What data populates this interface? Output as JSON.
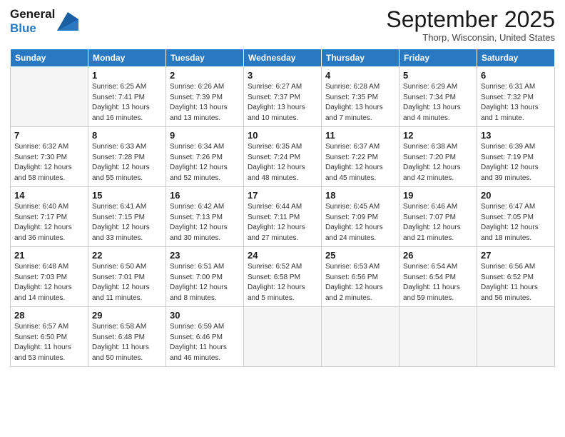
{
  "header": {
    "logo_line1": "General",
    "logo_line2": "Blue",
    "month_title": "September 2025",
    "location": "Thorp, Wisconsin, United States"
  },
  "days_of_week": [
    "Sunday",
    "Monday",
    "Tuesday",
    "Wednesday",
    "Thursday",
    "Friday",
    "Saturday"
  ],
  "weeks": [
    [
      {
        "day": "",
        "info": ""
      },
      {
        "day": "1",
        "info": "Sunrise: 6:25 AM\nSunset: 7:41 PM\nDaylight: 13 hours\nand 16 minutes."
      },
      {
        "day": "2",
        "info": "Sunrise: 6:26 AM\nSunset: 7:39 PM\nDaylight: 13 hours\nand 13 minutes."
      },
      {
        "day": "3",
        "info": "Sunrise: 6:27 AM\nSunset: 7:37 PM\nDaylight: 13 hours\nand 10 minutes."
      },
      {
        "day": "4",
        "info": "Sunrise: 6:28 AM\nSunset: 7:35 PM\nDaylight: 13 hours\nand 7 minutes."
      },
      {
        "day": "5",
        "info": "Sunrise: 6:29 AM\nSunset: 7:34 PM\nDaylight: 13 hours\nand 4 minutes."
      },
      {
        "day": "6",
        "info": "Sunrise: 6:31 AM\nSunset: 7:32 PM\nDaylight: 13 hours\nand 1 minute."
      }
    ],
    [
      {
        "day": "7",
        "info": "Sunrise: 6:32 AM\nSunset: 7:30 PM\nDaylight: 12 hours\nand 58 minutes."
      },
      {
        "day": "8",
        "info": "Sunrise: 6:33 AM\nSunset: 7:28 PM\nDaylight: 12 hours\nand 55 minutes."
      },
      {
        "day": "9",
        "info": "Sunrise: 6:34 AM\nSunset: 7:26 PM\nDaylight: 12 hours\nand 52 minutes."
      },
      {
        "day": "10",
        "info": "Sunrise: 6:35 AM\nSunset: 7:24 PM\nDaylight: 12 hours\nand 48 minutes."
      },
      {
        "day": "11",
        "info": "Sunrise: 6:37 AM\nSunset: 7:22 PM\nDaylight: 12 hours\nand 45 minutes."
      },
      {
        "day": "12",
        "info": "Sunrise: 6:38 AM\nSunset: 7:20 PM\nDaylight: 12 hours\nand 42 minutes."
      },
      {
        "day": "13",
        "info": "Sunrise: 6:39 AM\nSunset: 7:19 PM\nDaylight: 12 hours\nand 39 minutes."
      }
    ],
    [
      {
        "day": "14",
        "info": "Sunrise: 6:40 AM\nSunset: 7:17 PM\nDaylight: 12 hours\nand 36 minutes."
      },
      {
        "day": "15",
        "info": "Sunrise: 6:41 AM\nSunset: 7:15 PM\nDaylight: 12 hours\nand 33 minutes."
      },
      {
        "day": "16",
        "info": "Sunrise: 6:42 AM\nSunset: 7:13 PM\nDaylight: 12 hours\nand 30 minutes."
      },
      {
        "day": "17",
        "info": "Sunrise: 6:44 AM\nSunset: 7:11 PM\nDaylight: 12 hours\nand 27 minutes."
      },
      {
        "day": "18",
        "info": "Sunrise: 6:45 AM\nSunset: 7:09 PM\nDaylight: 12 hours\nand 24 minutes."
      },
      {
        "day": "19",
        "info": "Sunrise: 6:46 AM\nSunset: 7:07 PM\nDaylight: 12 hours\nand 21 minutes."
      },
      {
        "day": "20",
        "info": "Sunrise: 6:47 AM\nSunset: 7:05 PM\nDaylight: 12 hours\nand 18 minutes."
      }
    ],
    [
      {
        "day": "21",
        "info": "Sunrise: 6:48 AM\nSunset: 7:03 PM\nDaylight: 12 hours\nand 14 minutes."
      },
      {
        "day": "22",
        "info": "Sunrise: 6:50 AM\nSunset: 7:01 PM\nDaylight: 12 hours\nand 11 minutes."
      },
      {
        "day": "23",
        "info": "Sunrise: 6:51 AM\nSunset: 7:00 PM\nDaylight: 12 hours\nand 8 minutes."
      },
      {
        "day": "24",
        "info": "Sunrise: 6:52 AM\nSunset: 6:58 PM\nDaylight: 12 hours\nand 5 minutes."
      },
      {
        "day": "25",
        "info": "Sunrise: 6:53 AM\nSunset: 6:56 PM\nDaylight: 12 hours\nand 2 minutes."
      },
      {
        "day": "26",
        "info": "Sunrise: 6:54 AM\nSunset: 6:54 PM\nDaylight: 11 hours\nand 59 minutes."
      },
      {
        "day": "27",
        "info": "Sunrise: 6:56 AM\nSunset: 6:52 PM\nDaylight: 11 hours\nand 56 minutes."
      }
    ],
    [
      {
        "day": "28",
        "info": "Sunrise: 6:57 AM\nSunset: 6:50 PM\nDaylight: 11 hours\nand 53 minutes."
      },
      {
        "day": "29",
        "info": "Sunrise: 6:58 AM\nSunset: 6:48 PM\nDaylight: 11 hours\nand 50 minutes."
      },
      {
        "day": "30",
        "info": "Sunrise: 6:59 AM\nSunset: 6:46 PM\nDaylight: 11 hours\nand 46 minutes."
      },
      {
        "day": "",
        "info": ""
      },
      {
        "day": "",
        "info": ""
      },
      {
        "day": "",
        "info": ""
      },
      {
        "day": "",
        "info": ""
      }
    ]
  ]
}
